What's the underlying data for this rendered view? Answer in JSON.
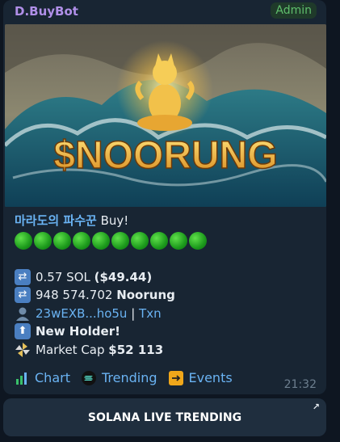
{
  "header": {
    "bot_name": "D.BuyBot",
    "role_badge": "Admin"
  },
  "banner": {
    "title": "$NOORUNG"
  },
  "message": {
    "buyer_name": "마라도의 파수꾼",
    "action": " Buy!",
    "emoji_dot_count": 10,
    "sol_amount": "0.57 SOL ",
    "usd_amount": "($49.44)",
    "token_amount": "948 574.702 ",
    "token_name": "Noorung",
    "wallet": "23wEXB...ho5u",
    "separator": " | ",
    "txn_label": "Txn",
    "new_holder": "New Holder!",
    "market_cap_label": "Market Cap ",
    "market_cap_value": "$52 113"
  },
  "actions": [
    {
      "label": "Chart",
      "icon": "chart-icon"
    },
    {
      "label": "Trending",
      "icon": "solana-icon"
    },
    {
      "label": "Events",
      "icon": "arrow-right-icon"
    }
  ],
  "timestamp": "21:32",
  "inline_button": {
    "label": "SOLANA LIVE TRENDING",
    "icon": "external-arrow-icon"
  },
  "colors": {
    "background": "#0e1621",
    "bubble": "#182533",
    "link": "#6ab3f3",
    "bot_name": "#b08fe8",
    "admin": "#5fbe6c"
  }
}
